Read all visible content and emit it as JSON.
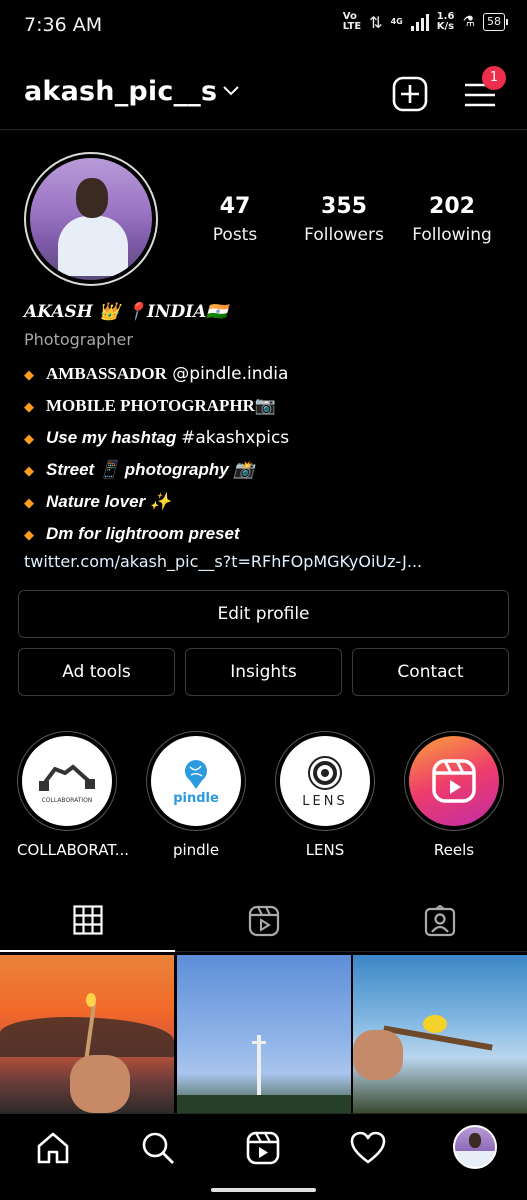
{
  "status_bar": {
    "time": "7:36 AM",
    "volte_top": "Vo",
    "volte_bottom": "LTE",
    "net_type": "4G",
    "speed_value": "1.6",
    "speed_unit": "K/s",
    "battery": "58"
  },
  "header": {
    "username": "akash_pic__s",
    "notification_count": "1"
  },
  "profile": {
    "stats": [
      {
        "value": "47",
        "label": "Posts"
      },
      {
        "value": "355",
        "label": "Followers"
      },
      {
        "value": "202",
        "label": "Following"
      }
    ],
    "bio": {
      "name": "AKASH  👑 📍INDIA🇮🇳",
      "category": "Photographer",
      "lines": [
        {
          "bold_text": "AMBASSADOR",
          "rest": " @pindle.india"
        },
        {
          "bold_text": "MOBILE PHOTOGRAPHR",
          "rest": "📷"
        },
        {
          "text": "Use my hashtag ",
          "tag": "#akashxpics"
        },
        {
          "text": "Street 📱 photography 📸"
        },
        {
          "text": "Nature lover ✨"
        },
        {
          "text": "Dm for lightroom preset"
        }
      ],
      "link": "twitter.com/akash_pic__s?t=RFhFOpMGKyOiUz-J..."
    }
  },
  "buttons": {
    "edit_profile": "Edit profile",
    "ad_tools": "Ad tools",
    "insights": "Insights",
    "contact": "Contact"
  },
  "highlights": [
    {
      "label": "COLLABORAT...",
      "inner_text": "COLLABORATION"
    },
    {
      "label": "pindle",
      "inner_text": "pindle"
    },
    {
      "label": "LENS",
      "inner_text": "LENS"
    },
    {
      "label": "Reels"
    }
  ],
  "tabs": [
    "grid-icon",
    "reels-icon",
    "tagged-icon"
  ],
  "nav": [
    "home-icon",
    "search-icon",
    "reels-icon",
    "heart-icon",
    "profile-avatar"
  ],
  "colors": {
    "background": "#000000",
    "divider": "#262626",
    "notification": "#ed2f4b",
    "bullet": "#ff9d1b",
    "link": "#e0f1ff",
    "category": "#a8a8a8"
  }
}
